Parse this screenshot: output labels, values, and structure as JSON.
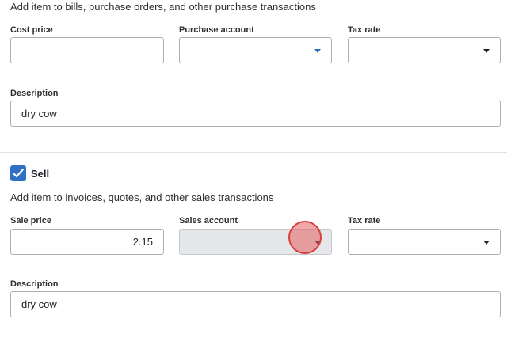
{
  "purchase": {
    "helper_text": "Add item to bills, purchase orders, and other purchase transactions",
    "cost_price_label": "Cost price",
    "cost_price_value": "",
    "purchase_account_label": "Purchase account",
    "purchase_account_value": "",
    "tax_rate_label": "Tax rate",
    "tax_rate_value": "",
    "description_label": "Description",
    "description_value": "dry cow"
  },
  "sell": {
    "checkbox_label": "Sell",
    "checked": true,
    "helper_text": "Add item to invoices, quotes, and other sales transactions",
    "sale_price_label": "Sale price",
    "sale_price_value": "2.15",
    "sales_account_label": "Sales account",
    "sales_account_value": "",
    "tax_rate_label": "Tax rate",
    "tax_rate_value": "",
    "description_label": "Description",
    "description_value": "dry cow"
  },
  "colors": {
    "accent": "#2f71c4",
    "click_indicator": "#e86060"
  }
}
